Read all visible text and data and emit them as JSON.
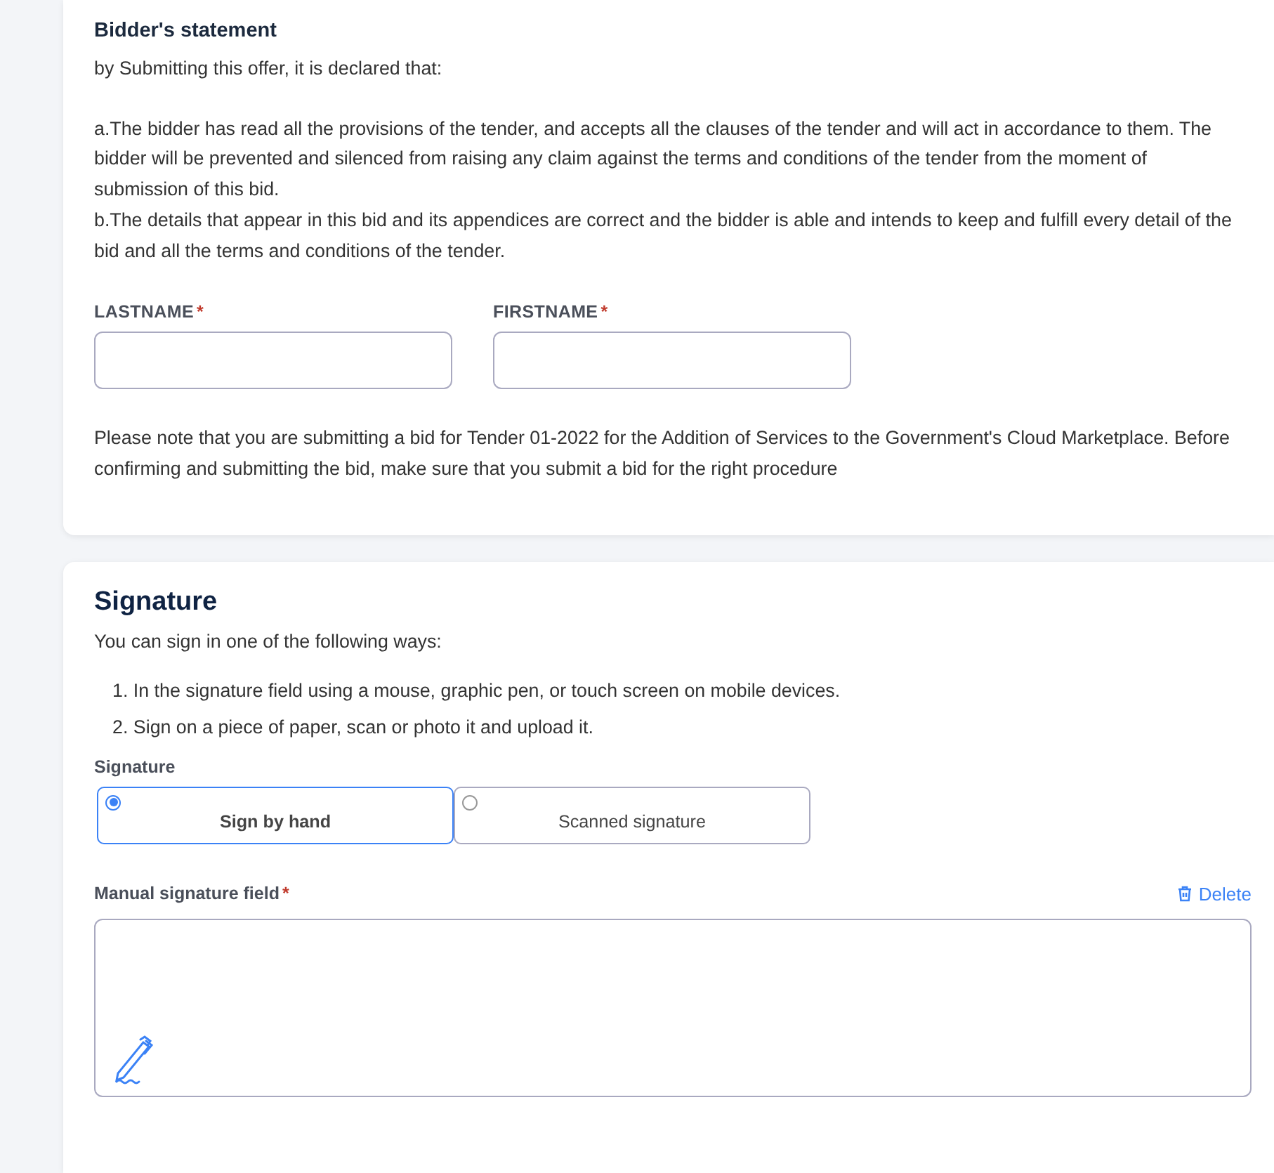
{
  "statement": {
    "title": "Bidder's statement",
    "intro": "by Submitting this offer, it is declared that:",
    "clauses": [
      "a.The bidder has read all the provisions of the tender, and accepts all the clauses of the tender and will act in accordance to them. The bidder will be prevented and silenced from raising any claim against the terms and conditions of the tender from the moment of submission of this bid.",
      "b.The details that appear in this bid and its appendices are correct and the bidder is able and intends to keep and fulfill every detail of the bid and all the terms and conditions of the tender."
    ],
    "fields": [
      {
        "label": "LASTNAME",
        "required_mark": "*"
      },
      {
        "label": "FIRSTNAME",
        "required_mark": "*"
      }
    ],
    "note": "Please note that you are submitting a bid for Tender 01-2022 for the Addition of Services to the Government's Cloud Marketplace. Before confirming and submitting the bid, make sure that you submit a bid for the right procedure"
  },
  "signature": {
    "title": "Signature",
    "intro": "You can sign in one of the following ways:",
    "steps": [
      {
        "number": "1.",
        "text": "In the signature field using a mouse, graphic pen, or touch screen on mobile devices."
      },
      {
        "number": "2.",
        "text": "Sign on a piece of paper, scan or photo it and upload it."
      }
    ],
    "method_label": "Signature",
    "options": [
      {
        "label": "Sign by hand",
        "selected": true
      },
      {
        "label": "Scanned signature",
        "selected": false
      }
    ],
    "field_label": "Manual signature field",
    "required_mark": "*",
    "delete_label": "Delete"
  }
}
